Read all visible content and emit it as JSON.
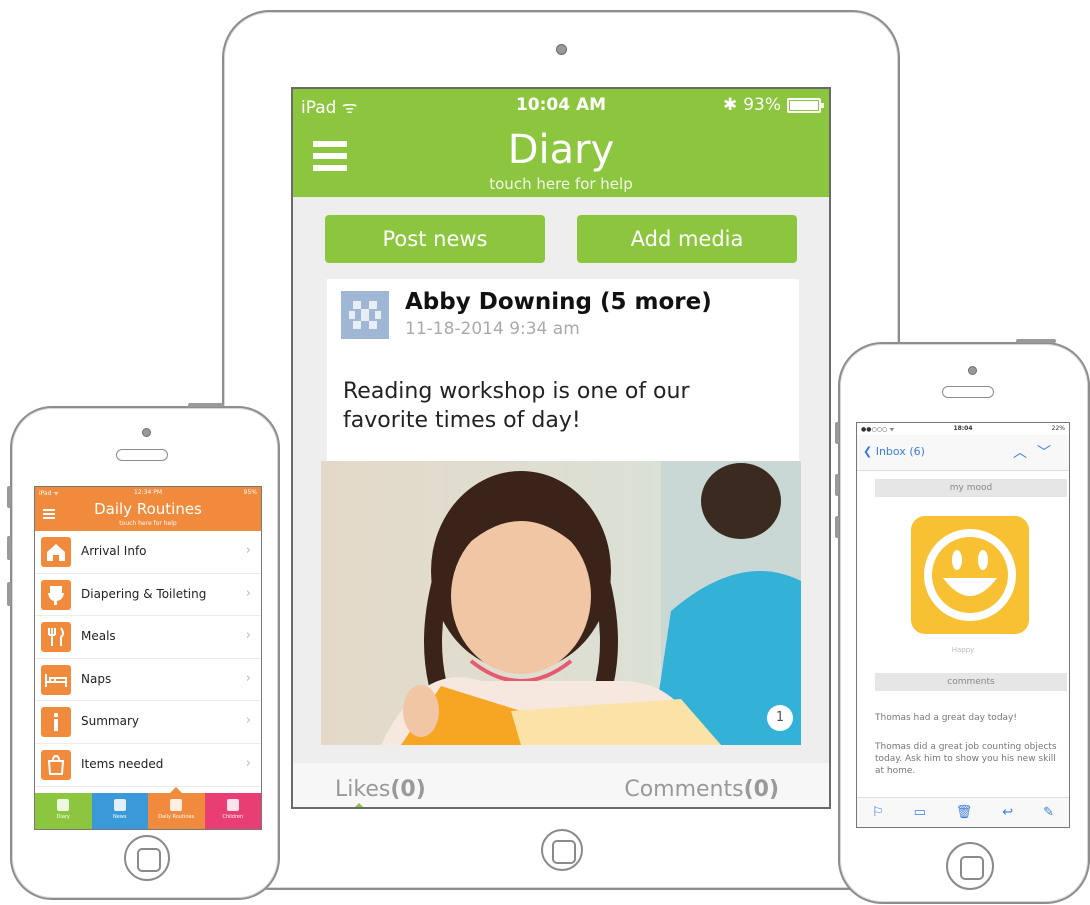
{
  "ipad": {
    "status": {
      "carrier": "iPad ᯤ",
      "time": "10:04 AM",
      "battery": "93%"
    },
    "header": {
      "title": "Diary",
      "subtitle": "touch here for help",
      "accent": "#8cc63f"
    },
    "buttons": {
      "post_news": "Post news",
      "add_media": "Add media"
    },
    "post": {
      "author": "Abby Downing (5 more)",
      "date": "11-18-2014 9:34 am",
      "text": "Reading workshop is one of our favorite times of day!",
      "photo_count": "1"
    },
    "footer": {
      "likes_label": "Likes",
      "likes_count": "(0)",
      "comments_label": "Comments",
      "comments_count": "(0)"
    }
  },
  "phone_left": {
    "status": {
      "carrier": "iPad ᯤ",
      "time": "12:34 PM",
      "battery": "95%"
    },
    "header": {
      "title": "Daily Routines",
      "subtitle": "touch here for help",
      "accent": "#f08a3c"
    },
    "items": [
      {
        "label": "Arrival Info",
        "icon": "house-icon"
      },
      {
        "label": "Diapering & Toileting",
        "icon": "toilet-icon"
      },
      {
        "label": "Meals",
        "icon": "utensils-icon"
      },
      {
        "label": "Naps",
        "icon": "bed-icon"
      },
      {
        "label": "Summary",
        "icon": "info-icon"
      },
      {
        "label": "Items needed",
        "icon": "bag-icon"
      }
    ],
    "tabs": [
      {
        "label": "Diary",
        "color": "#8cc63f"
      },
      {
        "label": "News",
        "color": "#3a9ad9"
      },
      {
        "label": "Daily Routines",
        "color": "#f08a3c"
      },
      {
        "label": "Children",
        "color": "#e83e74"
      }
    ]
  },
  "phone_right": {
    "status": {
      "carrier": "●●○○○ ᯤ",
      "time": "18:04",
      "battery": "22%"
    },
    "nav": {
      "back": "Inbox (6)"
    },
    "mood_label": "my mood",
    "mood_caption": "Happy",
    "comments_label": "comments",
    "message1": "Thomas had a great day today!",
    "message2": "Thomas did a great job counting objects today. Ask him to show you his new skill at home."
  }
}
